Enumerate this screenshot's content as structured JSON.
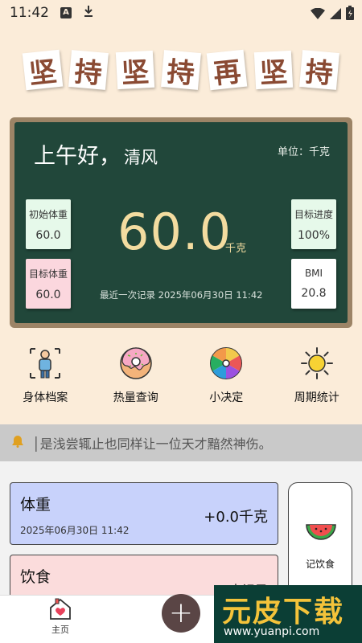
{
  "status_bar": {
    "time": "11:42",
    "notif_a": "A"
  },
  "banner": [
    "坚",
    "持",
    "坚",
    "持",
    "再",
    "坚",
    "持"
  ],
  "board": {
    "greeting": "上午好，",
    "name": "清风",
    "unit": "单位：千克",
    "current_weight": "60.0",
    "current_unit": "千克",
    "last_record": "最近一次记录 2025年06月30日 11:42",
    "cards": {
      "initial": {
        "label": "初始体重",
        "value": "60.0"
      },
      "target": {
        "label": "目标体重",
        "value": "60.0"
      },
      "progress": {
        "label": "目标进度",
        "value": "100%"
      },
      "bmi": {
        "label": "BMI",
        "value": "20.8"
      }
    }
  },
  "shortcuts": [
    {
      "label": "身体档案",
      "icon": "body-profile-icon"
    },
    {
      "label": "热量查询",
      "icon": "donut-icon"
    },
    {
      "label": "小决定",
      "icon": "color-wheel-icon"
    },
    {
      "label": "周期统计",
      "icon": "sun-icon"
    }
  ],
  "notice": {
    "icon": "bell-icon",
    "text": "│是浅尝辄止也同样让一位天才黯然神伤。"
  },
  "records": {
    "weight": {
      "title": "体重",
      "time": "2025年06月30日 11:42",
      "value": "+0.0千克"
    },
    "diet": {
      "title": "饮食",
      "status": "未记录"
    }
  },
  "side_panel": {
    "label": "记饮食",
    "icon": "watermelon-icon"
  },
  "bottom_nav": {
    "home_label": "主页",
    "add": "+"
  },
  "watermark": {
    "title": "元皮下载",
    "url": "www.yuanpi.com"
  },
  "colors": {
    "background": "#fbecd9",
    "board": "#21473a",
    "accent": "#f3dca0",
    "fab": "#5a4545"
  }
}
